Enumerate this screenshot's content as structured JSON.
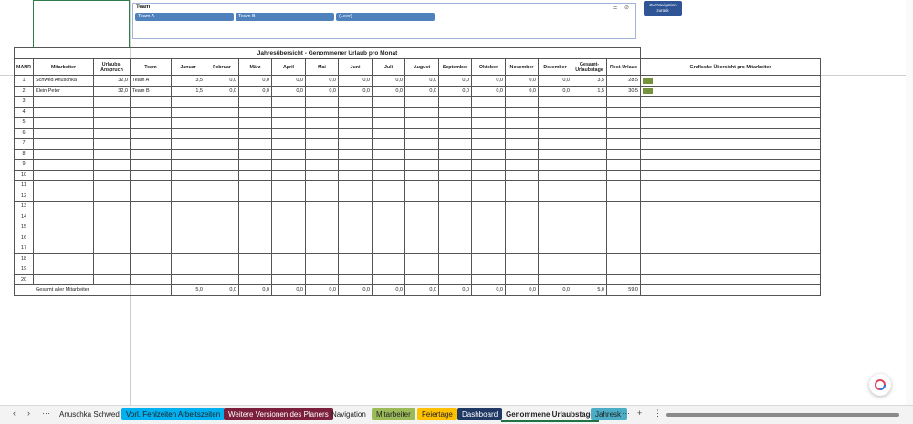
{
  "slicer": {
    "title": "Team",
    "buttons": [
      "Team A",
      "Team B",
      "(Leer)"
    ]
  },
  "nav_button": {
    "line1": "Zur Navigation",
    "line2": "zurück"
  },
  "table": {
    "title": "Jahresübersicht - Genommener Urlaub pro Monat",
    "headers": [
      "MANR",
      "Mitarbeiter",
      "Urlaubs-Anspruch",
      "Team",
      "Januar",
      "Februar",
      "März",
      "April",
      "Mai",
      "Juni",
      "Juli",
      "August",
      "September",
      "Oktober",
      "November",
      "Dezember",
      "Gesamt-Urlaubstage",
      "Rest-Urlaub",
      "Grafische Übersicht pro Mitarbeiter"
    ],
    "rows": [
      [
        "1",
        "Schwed Anuschka",
        "32,0",
        "Team A",
        "3,5",
        "0,0",
        "0,0",
        "0,0",
        "0,0",
        "0,0",
        "0,0",
        "0,0",
        "0,0",
        "0,0",
        "0,0",
        "0,0",
        "3,5",
        "28,5"
      ],
      [
        "2",
        "Klein Peter",
        "32,0",
        "Team B",
        "1,5",
        "0,0",
        "0,0",
        "0,0",
        "0,0",
        "0,0",
        "0,0",
        "0,0",
        "0,0",
        "0,0",
        "0,0",
        "0,0",
        "1,5",
        "30,5"
      ],
      [
        "3"
      ],
      [
        "4"
      ],
      [
        "5"
      ],
      [
        "6"
      ],
      [
        "7"
      ],
      [
        "8"
      ],
      [
        "9"
      ],
      [
        "10"
      ],
      [
        "11"
      ],
      [
        "12"
      ],
      [
        "13"
      ],
      [
        "14"
      ],
      [
        "15"
      ],
      [
        "16"
      ],
      [
        "17"
      ],
      [
        "18"
      ],
      [
        "19"
      ],
      [
        "20"
      ]
    ],
    "total_label": "Gesamt aller Mitarbeiter",
    "totals": [
      "5,0",
      "0,0",
      "0,0",
      "0,0",
      "0,0",
      "0,0",
      "0,0",
      "0,0",
      "0,0",
      "0,0",
      "0,0",
      "0,0",
      "5,0",
      "59,0"
    ],
    "bar_color": "#76923c"
  },
  "tabs": [
    {
      "label": "Anuschka Schwed",
      "bg": "",
      "fg": "#222222"
    },
    {
      "label": "Vorl. Fehlzeiten  Arbeitszeiten",
      "bg": "#00b0f0",
      "fg": "#222222"
    },
    {
      "label": "Weitere Versionen des Planers",
      "bg": "#7b1f3c",
      "fg": "#ffffff"
    },
    {
      "label": "Navigation",
      "bg": "",
      "fg": "#222222"
    },
    {
      "label": "Mitarbeiter",
      "bg": "#9bbb59",
      "fg": "#222222"
    },
    {
      "label": "Feiertage",
      "bg": "#ffc000",
      "fg": "#222222"
    },
    {
      "label": "Dashboard",
      "bg": "#1f3864",
      "fg": "#ffffff"
    },
    {
      "label": "Genommene Urlaubstage",
      "bg": "",
      "fg": "#222222",
      "active": true
    },
    {
      "label": "Jahresk",
      "bg": "#4bacc6",
      "fg": "#222222"
    }
  ]
}
